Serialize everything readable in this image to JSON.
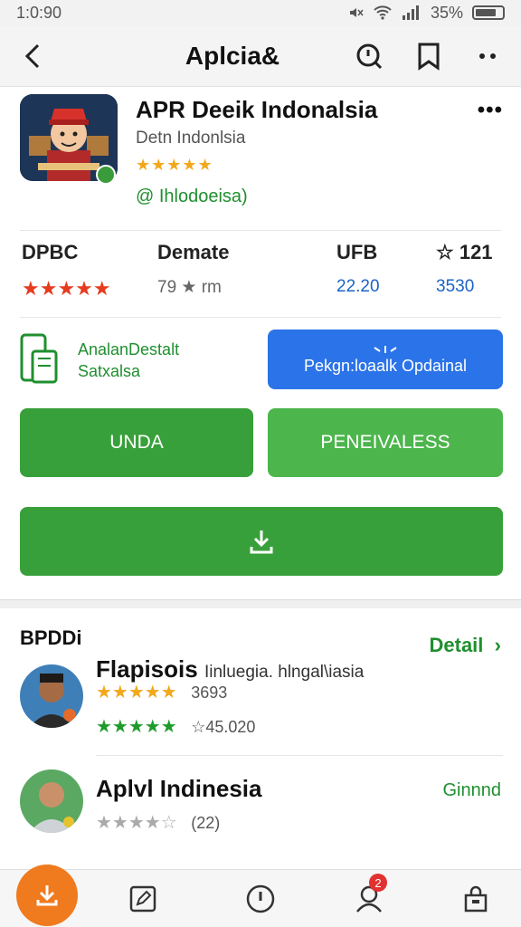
{
  "status_bar": {
    "time": "1:0:90",
    "battery": "35%"
  },
  "top_bar": {
    "title": "Aplcia&"
  },
  "app": {
    "name": "APR Deeik Indonalsia",
    "developer": "Detn Indonlsia",
    "stars": "★★★★★",
    "tag": "@ Ihlodoeisa)"
  },
  "stats": [
    {
      "label": "DPBC",
      "value": "★★★★★"
    },
    {
      "label": "Demate",
      "value": "79 ★ rm"
    },
    {
      "label": "UFB",
      "value": "22.20"
    },
    {
      "label": "☆ 121",
      "value": "3530"
    }
  ],
  "info": {
    "line1": "AnalanDestalt",
    "line2": "Satxalsa",
    "blue_button": "Pekgn:loaalk Opdainal"
  },
  "buttons": {
    "left": "UNDA",
    "right": "PENEIVALESS"
  },
  "reviews_section": {
    "label": "BPDDi",
    "detail": "Detail",
    "items": [
      {
        "name": "Flapisois",
        "subtitle": "Iinluegia. hlngal\\iasia",
        "line1_stars": "★★★★★",
        "line1_count": "3693",
        "line2_stars": "★★★★★",
        "line2_count": "☆45.020"
      },
      {
        "name": "Aplvl Indinesia",
        "action": "Ginnnd",
        "line1_stars": "★★★★☆",
        "line1_count": "(22)"
      }
    ]
  },
  "bottom_nav": {
    "badge": "2"
  },
  "colors": {
    "green": "#38a03a",
    "blue": "#2b73e8",
    "orange": "#f07a1e",
    "red_stars": "#e63b1e"
  }
}
